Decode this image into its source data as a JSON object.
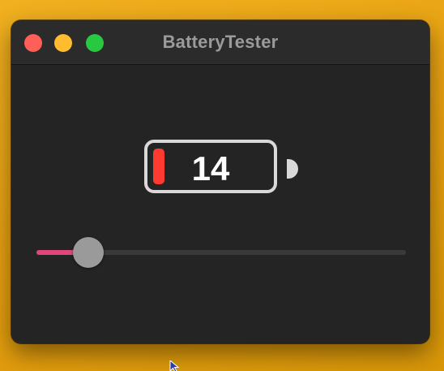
{
  "window": {
    "title": "BatteryTester"
  },
  "battery": {
    "value": "14",
    "level_percent": 14,
    "fill_color": "#ff3a30"
  },
  "slider": {
    "value": 14,
    "min": 0,
    "max": 100,
    "accent_color": "#e0467a"
  },
  "icons": {
    "close": "close-icon",
    "minimize": "minimize-icon",
    "zoom": "zoom-icon",
    "cursor": "mouse-pointer-icon"
  }
}
